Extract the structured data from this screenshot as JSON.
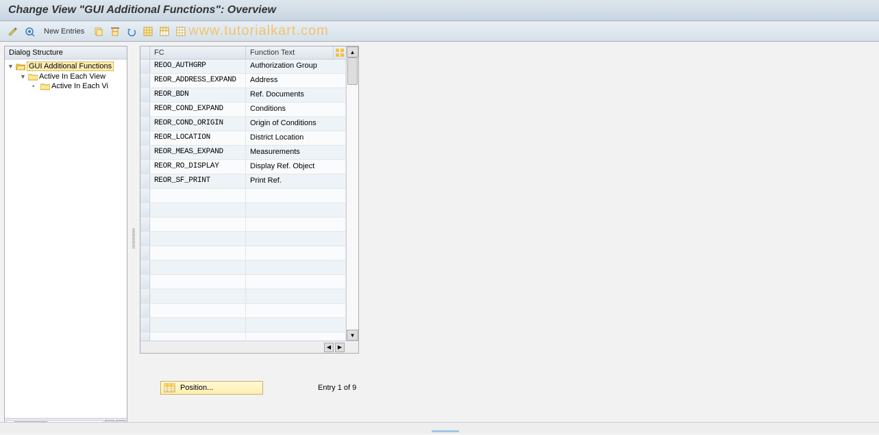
{
  "header": {
    "title": "Change View \"GUI Additional Functions\": Overview"
  },
  "toolbar": {
    "new_entries": "New Entries",
    "watermark": "www.tutorialkart.com"
  },
  "tree": {
    "header": "Dialog Structure",
    "items": [
      {
        "level": 1,
        "label": "GUI Additional Functions",
        "open": true,
        "selected": true
      },
      {
        "level": 2,
        "label": "Active In Each View",
        "open": true,
        "selected": false
      },
      {
        "level": 3,
        "label": "Active In Each Vi",
        "open": false,
        "selected": false
      }
    ]
  },
  "table": {
    "col_fc": "FC",
    "col_func_text": "Function Text",
    "rows": [
      {
        "fc": "REOO_AUTHGRP",
        "text": "Authorization Group"
      },
      {
        "fc": "REOR_ADDRESS_EXPAND",
        "text": "Address"
      },
      {
        "fc": "REOR_BDN",
        "text": "Ref. Documents"
      },
      {
        "fc": "REOR_COND_EXPAND",
        "text": "Conditions"
      },
      {
        "fc": "REOR_COND_ORIGIN",
        "text": "Origin of Conditions"
      },
      {
        "fc": "REOR_LOCATION",
        "text": "District Location"
      },
      {
        "fc": "REOR_MEAS_EXPAND",
        "text": "Measurements"
      },
      {
        "fc": "REOR_RO_DISPLAY",
        "text": "Display Ref. Object"
      },
      {
        "fc": "REOR_SF_PRINT",
        "text": "Print Ref."
      },
      {
        "fc": "",
        "text": ""
      },
      {
        "fc": "",
        "text": ""
      },
      {
        "fc": "",
        "text": ""
      },
      {
        "fc": "",
        "text": ""
      },
      {
        "fc": "",
        "text": ""
      },
      {
        "fc": "",
        "text": ""
      },
      {
        "fc": "",
        "text": ""
      },
      {
        "fc": "",
        "text": ""
      },
      {
        "fc": "",
        "text": ""
      },
      {
        "fc": "",
        "text": ""
      },
      {
        "fc": "",
        "text": ""
      }
    ]
  },
  "footer": {
    "position_btn": "Position...",
    "entry_text": "Entry 1 of 9"
  }
}
